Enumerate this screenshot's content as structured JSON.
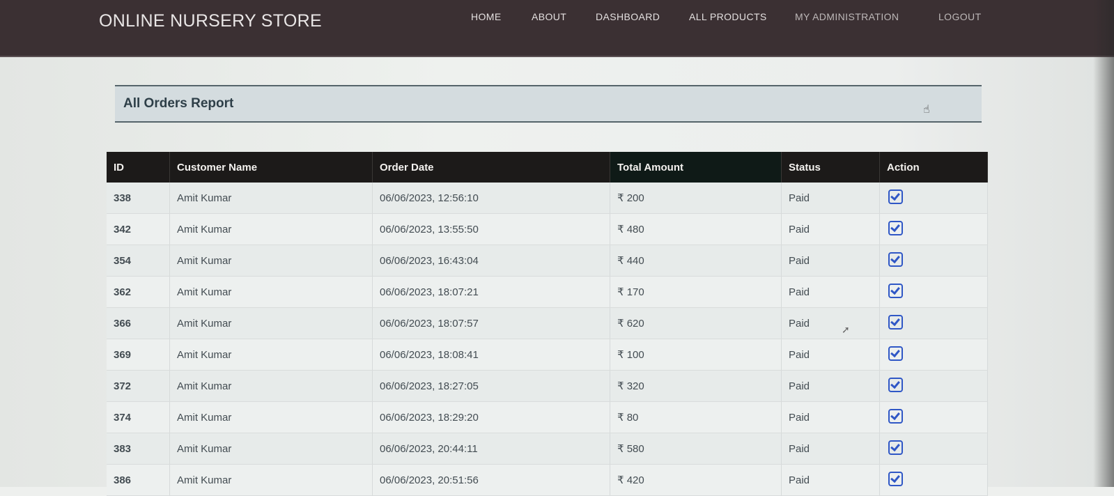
{
  "brand": "ONLINE NURSERY STORE",
  "nav": [
    {
      "label": "HOME"
    },
    {
      "label": "ABOUT"
    },
    {
      "label": "DASHBOARD"
    },
    {
      "label": "ALL PRODUCTS"
    },
    {
      "label": "MY ADMINISTRATION"
    },
    {
      "label": "LOGOUT"
    }
  ],
  "report": {
    "title": "All Orders Report"
  },
  "table": {
    "headers": [
      "ID",
      "Customer Name",
      "Order Date",
      "Total Amount",
      "Status",
      "Action"
    ],
    "rows": [
      {
        "id": "338",
        "customer": "Amit Kumar",
        "date": "06/06/2023, 12:56:10",
        "amount": "₹ 200",
        "status": "Paid",
        "action_icon": "edit-check-icon"
      },
      {
        "id": "342",
        "customer": "Amit Kumar",
        "date": "06/06/2023, 13:55:50",
        "amount": "₹ 480",
        "status": "Paid",
        "action_icon": "edit-check-icon"
      },
      {
        "id": "354",
        "customer": "Amit Kumar",
        "date": "06/06/2023, 16:43:04",
        "amount": "₹ 440",
        "status": "Paid",
        "action_icon": "edit-check-icon"
      },
      {
        "id": "362",
        "customer": "Amit Kumar",
        "date": "06/06/2023, 18:07:21",
        "amount": "₹ 170",
        "status": "Paid",
        "action_icon": "edit-check-icon"
      },
      {
        "id": "366",
        "customer": "Amit Kumar",
        "date": "06/06/2023, 18:07:57",
        "amount": "₹ 620",
        "status": "Paid",
        "action_icon": "edit-check-icon"
      },
      {
        "id": "369",
        "customer": "Amit Kumar",
        "date": "06/06/2023, 18:08:41",
        "amount": "₹ 100",
        "status": "Paid",
        "action_icon": "edit-check-icon"
      },
      {
        "id": "372",
        "customer": "Amit Kumar",
        "date": "06/06/2023, 18:27:05",
        "amount": "₹ 320",
        "status": "Paid",
        "action_icon": "edit-check-icon"
      },
      {
        "id": "374",
        "customer": "Amit Kumar",
        "date": "06/06/2023, 18:29:20",
        "amount": "₹ 80",
        "status": "Paid",
        "action_icon": "edit-check-icon"
      },
      {
        "id": "383",
        "customer": "Amit Kumar",
        "date": "06/06/2023, 20:44:11",
        "amount": "₹ 580",
        "status": "Paid",
        "action_icon": "edit-check-icon"
      },
      {
        "id": "386",
        "customer": "Amit Kumar",
        "date": "06/06/2023, 20:51:56",
        "amount": "₹ 420",
        "status": "Paid",
        "action_icon": "edit-check-icon"
      }
    ]
  },
  "colors": {
    "topbar": "#3b3033",
    "table_header": "#1c1a19",
    "action_icon": "#2f57c6",
    "report_band": "#d4dcdf"
  }
}
